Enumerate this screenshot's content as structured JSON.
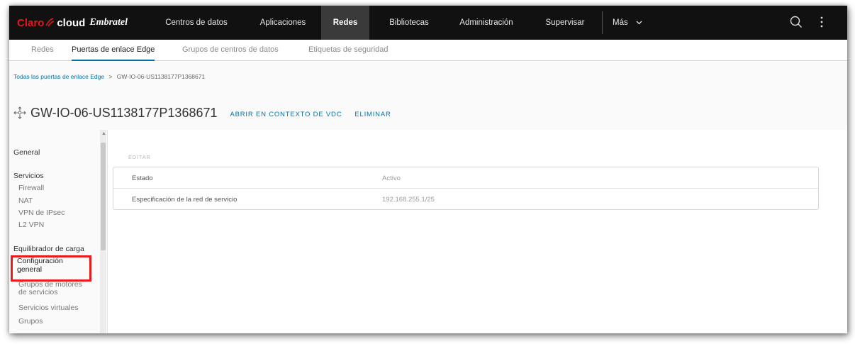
{
  "app": {
    "brand_claro": "Claro",
    "brand_cloud": "cloud",
    "brand_embratel": "Embratel"
  },
  "nav": {
    "items": [
      {
        "label": "Centros de datos"
      },
      {
        "label": "Aplicaciones"
      },
      {
        "label": "Redes",
        "active": true
      },
      {
        "label": "Bibliotecas"
      },
      {
        "label": "Administración"
      },
      {
        "label": "Supervisar"
      }
    ],
    "more_label": "Más",
    "search_icon": "search-icon",
    "menu_icon": "vertical-dots-icon"
  },
  "subnav": {
    "tabs": [
      {
        "label": "Redes"
      },
      {
        "label": "Puertas de enlace Edge",
        "active": true
      },
      {
        "label": "Grupos de centros de datos"
      },
      {
        "label": "Etiquetas de seguridad"
      }
    ]
  },
  "breadcrumb": {
    "parent": "Todas las puertas de enlace Edge",
    "separator": ">",
    "current": "GW-IO-06-US1138177P1368671"
  },
  "page": {
    "title": "GW-IO-06-US1138177P1368671",
    "title_icon": "edge-gateway-icon",
    "action_open": "ABRIR EN CONTEXTO DE VDC",
    "action_delete": "ELIMINAR"
  },
  "sidebar": {
    "general": "General",
    "services": "Servicios",
    "services_items": [
      "Firewall",
      "NAT",
      "VPN de IPsec",
      "L2 VPN"
    ],
    "load_balancer": "Equilibrador de carga",
    "lb_active_line1": "Configuración",
    "lb_active_line2": "general",
    "lb_items": [
      {
        "line1": "Grupos de motores",
        "line2": "de servicios"
      },
      {
        "line1": "Servicios virtuales",
        "line2": ""
      },
      {
        "line1": "Grupos",
        "line2": ""
      }
    ]
  },
  "detail": {
    "edit_label": "EDITAR",
    "rows": [
      {
        "label": "Estado",
        "value": "Activo"
      },
      {
        "label": "Especificación de la red de servicio",
        "value": "192.168.255.1/25"
      }
    ]
  },
  "colors": {
    "topbar": "#111111",
    "accent": "#0072a3",
    "highlight": "#e81c1c",
    "brand_red": "#e4161b"
  }
}
